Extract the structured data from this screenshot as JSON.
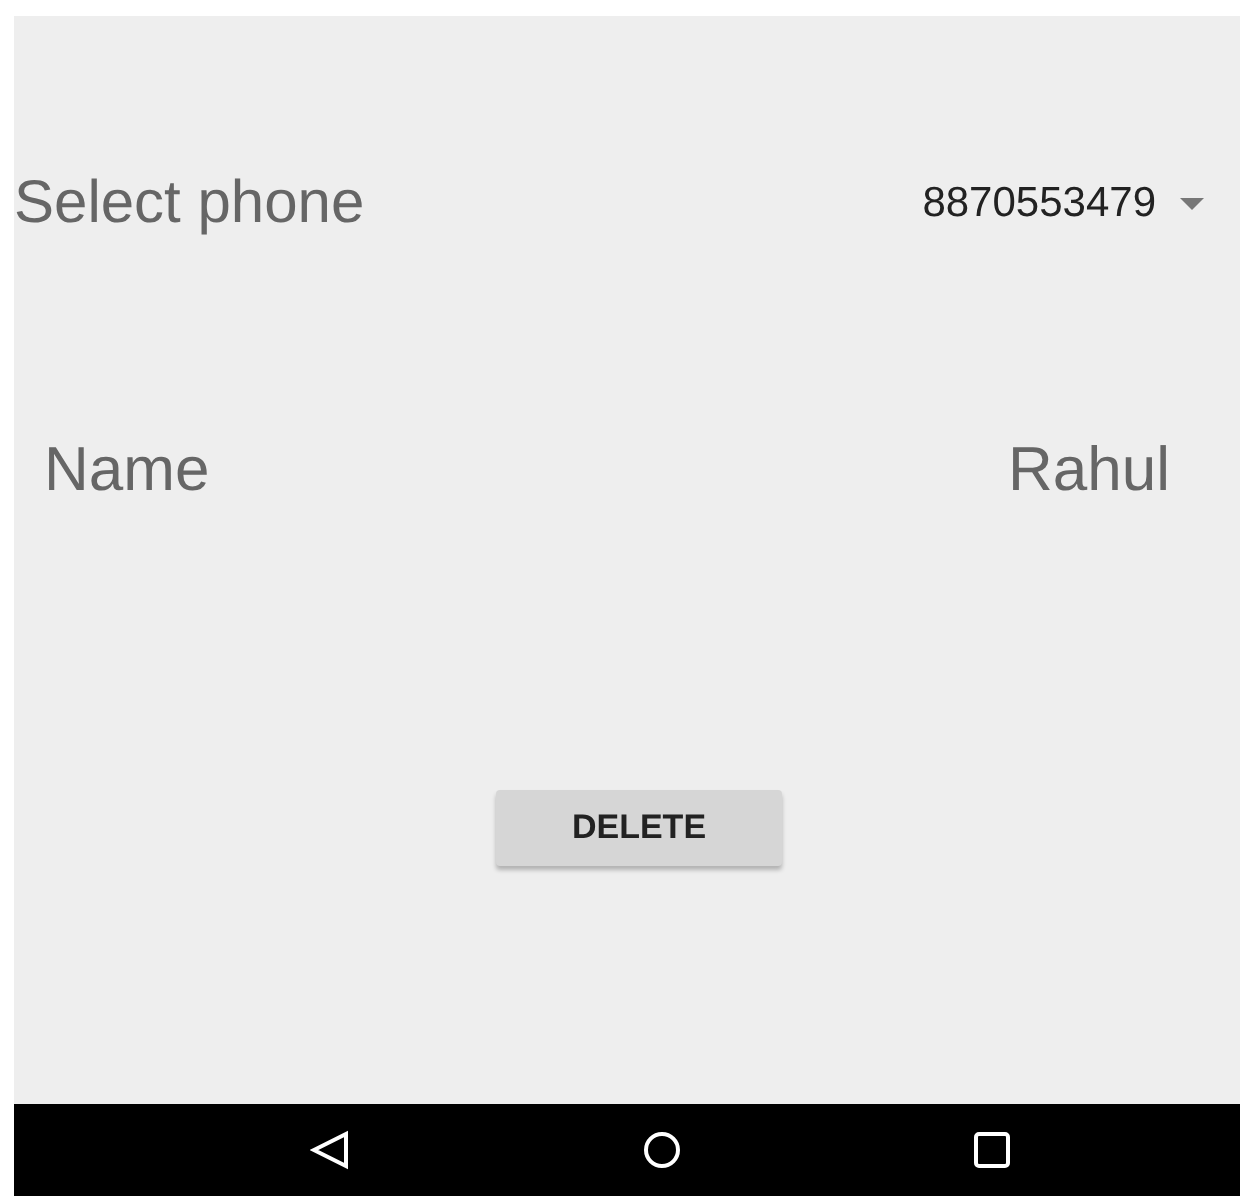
{
  "phone_row": {
    "label": "Select phone",
    "selected_value": "8870553479"
  },
  "name_row": {
    "label": "Name",
    "value": "Rahul"
  },
  "delete_button": "DELETE"
}
